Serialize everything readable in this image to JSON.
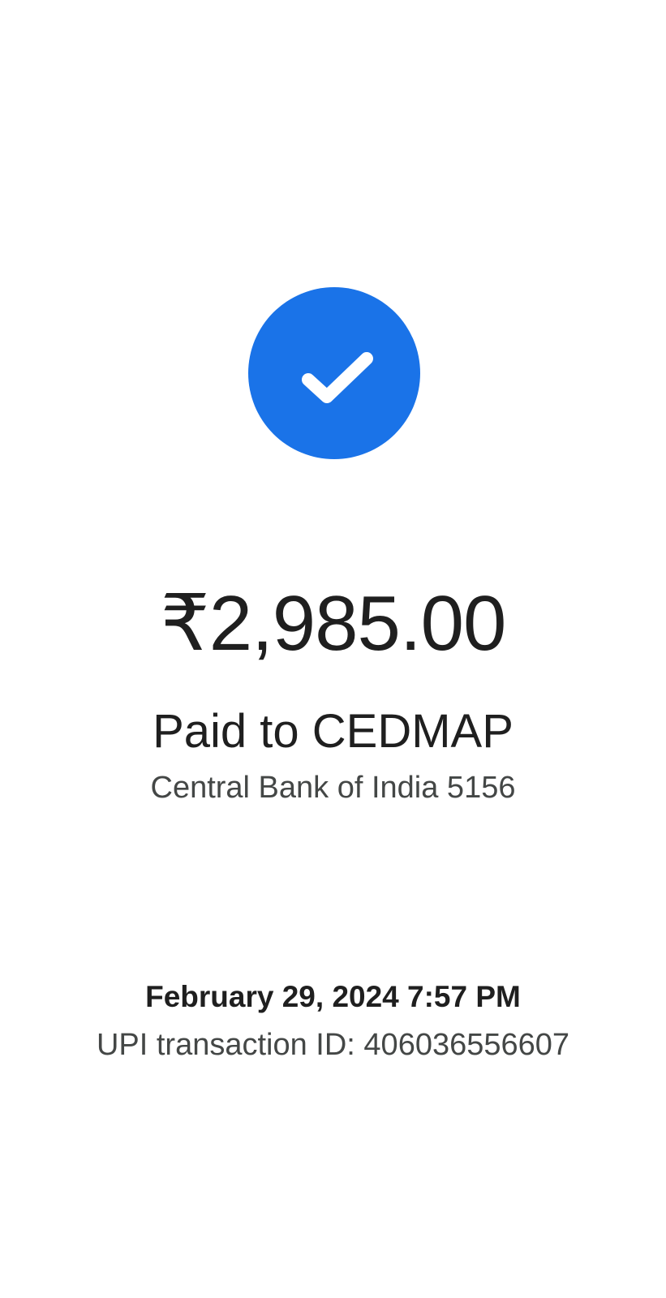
{
  "status": {
    "icon": "checkmark-icon",
    "accent_color": "#1a73e8"
  },
  "payment": {
    "amount": "₹2,985.00",
    "paid_to": "Paid to CEDMAP",
    "bank": "Central Bank of India 5156"
  },
  "transaction": {
    "datetime": "February 29, 2024 7:57 PM",
    "upi_id_text": "UPI transaction ID: 406036556607"
  }
}
